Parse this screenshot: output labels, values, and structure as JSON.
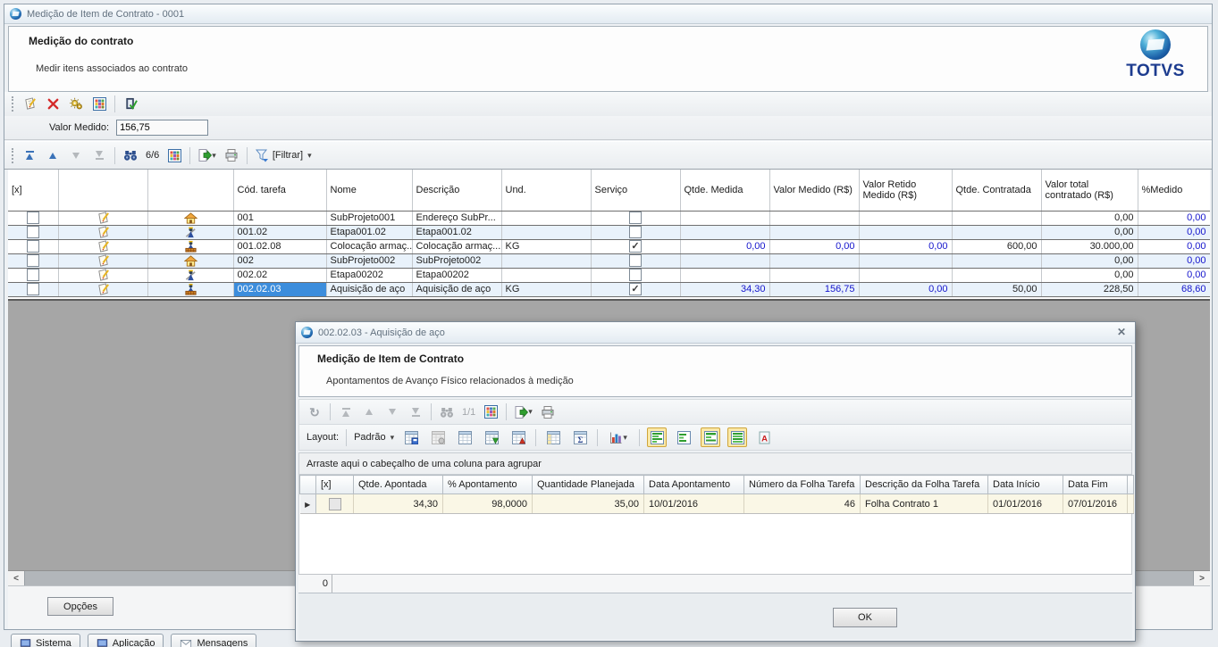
{
  "icons": {
    "caret_down": "▾",
    "close": "✕",
    "refresh": "↻",
    "scroll_left": "<",
    "scroll_right": ">",
    "row_marker": "▶"
  },
  "main": {
    "window_title": "Medição de Item de Contrato - 0001",
    "header": {
      "title": "Medição do contrato",
      "subtitle": "Medir itens associados ao contrato",
      "brand": "TOTVS"
    },
    "fields": {
      "valor_medido_label": "Valor Medido:",
      "valor_medido_value": "156,75"
    },
    "nav": {
      "counter": "6/6",
      "filter_label": "[Filtrar]"
    },
    "table": {
      "columns": [
        "[x]",
        "",
        "",
        "Cód. tarefa",
        "Nome",
        "Descrição",
        "Und.",
        "Serviço",
        "Qtde. Medida",
        "Valor Medido (R$)",
        "Valor Retido Medido (R$)",
        "Qtde. Contratada",
        "Valor total contratado (R$)",
        "%Medido"
      ],
      "rows": [
        {
          "tipo": "subprojeto",
          "selected": false,
          "servico": false,
          "cod": "001",
          "nome": "SubProjeto001",
          "desc": "Endereço SubPr...",
          "und": "",
          "qtde_medida": "",
          "valor_medido": "",
          "valor_retido": "",
          "qtde_contratada": "",
          "valor_total": "0,00",
          "pct_medido": "0,00"
        },
        {
          "tipo": "etapa",
          "selected": false,
          "servico": false,
          "cod": "001.02",
          "nome": "Etapa001.02",
          "desc": "Etapa001.02",
          "und": "",
          "qtde_medida": "",
          "valor_medido": "",
          "valor_retido": "",
          "qtde_contratada": "",
          "valor_total": "0,00",
          "pct_medido": "0,00"
        },
        {
          "tipo": "tarefa",
          "selected": false,
          "servico": true,
          "cod": "001.02.08",
          "nome": "Colocação armaç...",
          "desc": "Colocação armaç...",
          "und": "KG",
          "qtde_medida": "0,00",
          "valor_medido": "0,00",
          "valor_retido": "0,00",
          "qtde_contratada": "600,00",
          "valor_total": "30.000,00",
          "pct_medido": "0,00"
        },
        {
          "tipo": "subprojeto",
          "selected": false,
          "servico": false,
          "cod": "002",
          "nome": "SubProjeto002",
          "desc": "SubProjeto002",
          "und": "",
          "qtde_medida": "",
          "valor_medido": "",
          "valor_retido": "",
          "qtde_contratada": "",
          "valor_total": "0,00",
          "pct_medido": "0,00"
        },
        {
          "tipo": "etapa",
          "selected": false,
          "servico": false,
          "cod": "002.02",
          "nome": "Etapa00202",
          "desc": "Etapa00202",
          "und": "",
          "qtde_medida": "",
          "valor_medido": "",
          "valor_retido": "",
          "qtde_contratada": "",
          "valor_total": "0,00",
          "pct_medido": "0,00"
        },
        {
          "tipo": "tarefa",
          "selected": true,
          "servico": true,
          "cod": "002.02.03",
          "nome": "Aquisição de aço",
          "desc": "Aquisição de aço",
          "und": "KG",
          "qtde_medida": "34,30",
          "valor_medido": "156,75",
          "valor_retido": "0,00",
          "qtde_contratada": "50,00",
          "valor_total": "228,50",
          "pct_medido": "68,60"
        }
      ]
    },
    "footer": {
      "opcoes_label": "Opções"
    },
    "tabs": [
      {
        "label": "Sistema"
      },
      {
        "label": "Aplicação"
      },
      {
        "label": "Mensagens"
      }
    ]
  },
  "dialog": {
    "window_title": "002.02.03 - Aquisição de aço",
    "header": {
      "title": "Medição de Item de Contrato",
      "subtitle": "Apontamentos de Avanço Físico relacionados à medição"
    },
    "nav": {
      "counter": "1/1"
    },
    "layout": {
      "label": "Layout:",
      "value": "Padrão"
    },
    "group_hint": "Arraste aqui o cabeçalho de uma coluna para agrupar",
    "table": {
      "columns": [
        "[x]",
        "Qtde. Apontada",
        "% Apontamento",
        "Quantidade Planejada",
        "Data Apontamento",
        "Número da Folha Tarefa",
        "Descrição da Folha Tarefa",
        "Data Início",
        "Data Fim"
      ],
      "rows": [
        {
          "qtde_apontada": "34,30",
          "pct_apontamento": "98,0000",
          "quantidade_planejada": "35,00",
          "data_apontamento": "10/01/2016",
          "numero_folha": "46",
          "descricao_folha": "Folha Contrato 1",
          "data_inicio": "01/01/2016",
          "data_fim": "07/01/2016"
        }
      ]
    },
    "status": {
      "count": "0"
    },
    "footer": {
      "ok_label": "OK"
    }
  }
}
